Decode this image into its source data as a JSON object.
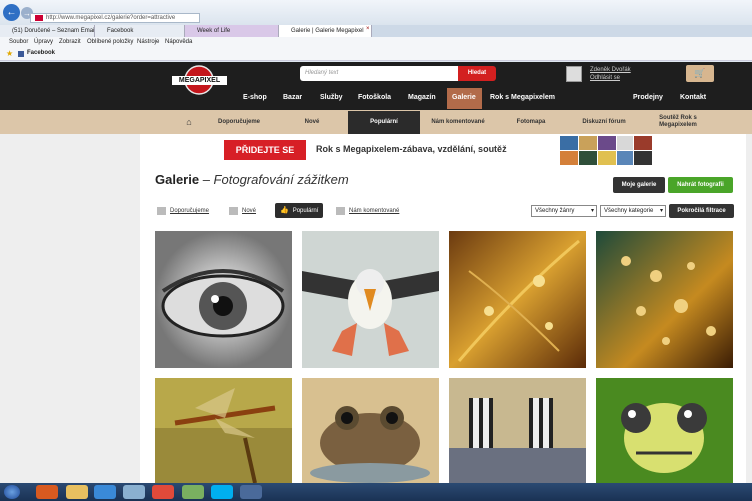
{
  "browser": {
    "url": "http://www.megapixel.cz/galerie?order=attractive",
    "url_domain": "megapixel.cz",
    "tabs": [
      {
        "label": "(51) Doručené – Seznam Email"
      },
      {
        "label": "Facebook"
      },
      {
        "label": "Week of Life"
      },
      {
        "label": "Galerie | Galerie Megapixel"
      }
    ],
    "menu": [
      "Soubor",
      "Úpravy",
      "Zobrazit",
      "Oblíbené položky",
      "Nástroje",
      "Nápověda"
    ],
    "favorites": [
      {
        "label": "Facebook"
      }
    ]
  },
  "site": {
    "logo_text": "MEGAPIXEL",
    "search_placeholder": "Hledaný text",
    "search_button": "Hledat",
    "user_name": "Zdeněk Dvořák",
    "logout": "Odhlásit se",
    "main_nav": [
      "E-shop",
      "Bazar",
      "Služby",
      "Fotoškola",
      "Magazín",
      "Galerie",
      "Rok s Megapixelem"
    ],
    "main_nav_right": [
      "Prodejny",
      "Kontakt"
    ],
    "sub_nav": [
      "Doporučujeme",
      "Nové",
      "Populární",
      "Nám komentované",
      "Fotomapa",
      "Diskuzní fórum",
      "Soutěž Rok s Megapixelem"
    ]
  },
  "banner": {
    "cta": "PŘIDEJTE SE",
    "text": "Rok s Megapixelem-zábava, vzdělání, soutěž"
  },
  "gallery": {
    "title": "Galerie",
    "subtitle": "– Fotografování zážitkem",
    "my_gallery": "Moje galerie",
    "upload": "Nahrát fotografii",
    "filters": [
      "Doporučujeme",
      "Nové",
      "Populární",
      "Nám komentované"
    ],
    "genre_select": "Všechny žánry",
    "category_select": "Všechny kategorie",
    "advanced": "Pokročilá filtrace",
    "photos": [
      "eye",
      "puffin",
      "leaf",
      "drops",
      "dragonfly",
      "frog",
      "zebras",
      "damselfly"
    ]
  },
  "colors": {
    "header_bg": "#1e1e1e",
    "accent_red": "#d32020",
    "subnav_bg": "#dcc6a9",
    "active_nav": "#b26b4a",
    "upload_green": "#4aa529"
  }
}
